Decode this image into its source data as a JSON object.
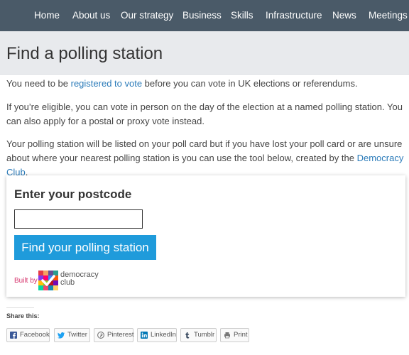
{
  "nav": {
    "items": [
      "Home",
      "About us",
      "Our strategy",
      "Business",
      "Skills",
      "Infrastructure",
      "News",
      "Meetings"
    ]
  },
  "page": {
    "title": "Find a polling station"
  },
  "content": {
    "p1_before": "You need to be ",
    "p1_link": "registered to vote",
    "p1_after": " before you can vote in UK elections or referendums.",
    "p2": "If you’re eligible, you can vote in person on the day of the election at a named polling station. You can also apply for a postal or proxy vote instead.",
    "p3_before": "Your polling station will be listed on your poll card but if you have lost your poll card or are unsure about where your nearest polling station is you can use the tool below, created by the ",
    "p3_link": "Democracy Club",
    "p3_after": "."
  },
  "widget": {
    "heading": "Enter your postcode",
    "postcode_value": "",
    "button_label": "Find your polling station",
    "built_by": "Built by",
    "logo_line1": "democracy",
    "logo_line2": "club"
  },
  "share": {
    "title": "Share this:",
    "buttons": [
      "Facebook",
      "Twitter",
      "Pinterest",
      "LinkedIn",
      "Tumblr",
      "Print"
    ]
  },
  "colors": {
    "nav_bg": "#4a5a68",
    "link": "#2b7bb9",
    "button": "#1f9bdb",
    "built_by": "#d6336c"
  }
}
